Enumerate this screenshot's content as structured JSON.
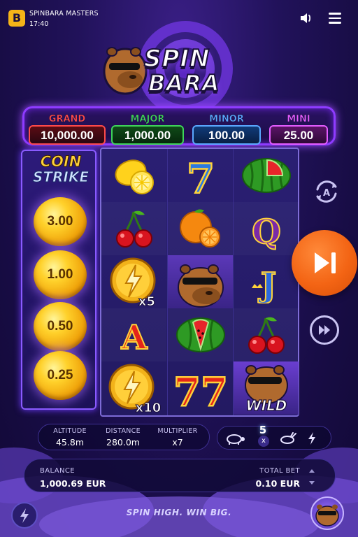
{
  "header": {
    "brand_letter": "B",
    "app_title": "SPINBARA MASTERS",
    "clock": "17:40"
  },
  "logo": {
    "line1": "SPIN",
    "line2": "BARA"
  },
  "jackpots": [
    {
      "label": "GRAND",
      "value": "10,000.00",
      "color": "#ff4a4a"
    },
    {
      "label": "MAJOR",
      "value": "1,000.00",
      "color": "#3fd45a"
    },
    {
      "label": "MINOR",
      "value": "100.00",
      "color": "#5aa8ff"
    },
    {
      "label": "MINI",
      "value": "25.00",
      "color": "#e45cff"
    }
  ],
  "coin_strike": {
    "title_line1": "COIN",
    "title_line2": "STRIKE",
    "prizes": [
      "3.00",
      "1.00",
      "0.50",
      "0.25"
    ]
  },
  "reels": {
    "symbols": [
      [
        "lemon",
        "cherries",
        "lightning-coin-x5",
        "letter-a",
        "lightning-coin-x10"
      ],
      [
        "seven-blue",
        "orange",
        "capybara",
        "watermelon",
        "triple-seven"
      ],
      [
        "watermelon",
        "letter-q",
        "letter-j",
        "cherries",
        "capybara-wild"
      ]
    ],
    "coin_multipliers": {
      "x5": "x5",
      "x10": "x10"
    },
    "letters": {
      "a": "A",
      "q": "Q",
      "j": "J",
      "seven": "7",
      "triple": "77"
    },
    "wild_label": "WILD"
  },
  "stats": {
    "altitude_label": "ALTITUDE",
    "altitude_value": "45.8m",
    "distance_label": "DISTANCE",
    "distance_value": "280.0m",
    "multiplier_label": "MULTIPLIER",
    "multiplier_value": "x7"
  },
  "speed": {
    "marker_value": "5",
    "marker_unit": "x"
  },
  "balance": {
    "label": "BALANCE",
    "value": "1,000.69 EUR",
    "bet_label": "TOTAL BET",
    "bet_value": "0.10 EUR"
  },
  "footer": {
    "tagline": "SPIN HIGH. WIN BIG."
  },
  "colors": {
    "spin_button": "#f36414",
    "accent_purple": "#8e3bff",
    "coin_gold": "#ffd12b"
  }
}
